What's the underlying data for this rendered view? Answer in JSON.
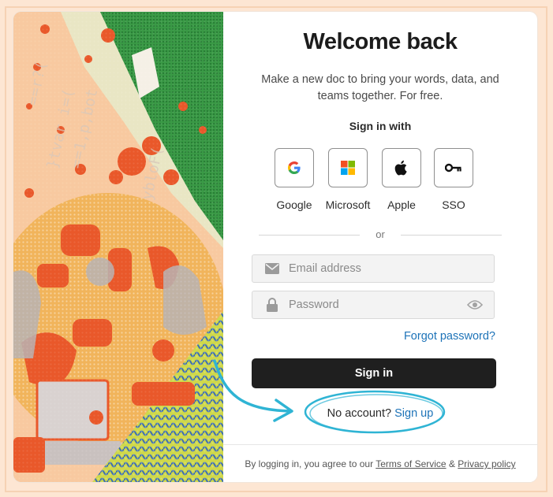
{
  "header": {
    "title": "Welcome back",
    "subtitle": "Make a new doc to bring your words, data, and teams together. For free."
  },
  "providers": {
    "heading": "Sign in with",
    "items": [
      {
        "label": "Google",
        "icon": "google-icon"
      },
      {
        "label": "Microsoft",
        "icon": "microsoft-icon"
      },
      {
        "label": "Apple",
        "icon": "apple-icon"
      },
      {
        "label": "SSO",
        "icon": "key-icon"
      }
    ]
  },
  "divider": {
    "text": "or"
  },
  "form": {
    "email_placeholder": "Email address",
    "email_value": "",
    "password_placeholder": "Password",
    "password_value": "",
    "forgot_label": "Forgot password?",
    "submit_label": "Sign in"
  },
  "signup": {
    "prompt": "No account?",
    "link_label": "Sign up"
  },
  "footer": {
    "prefix": "By logging in, you agree to our",
    "terms_label": "Terms of Service",
    "ampersand": "&",
    "privacy_label": "Privacy policy"
  },
  "illustration": {
    "code_lines": [
      "==r?(",
      "}tvar i=(",
      "==1,p,bot",
      "ybloF("
    ]
  },
  "colors": {
    "accent_link": "#1d73b8",
    "primary_button": "#1f1f1f",
    "annotation": "#2fb4d4",
    "illustration_orange": "#e9582a",
    "illustration_green": "#2f8a3a",
    "page_background": "#fde6d3"
  }
}
